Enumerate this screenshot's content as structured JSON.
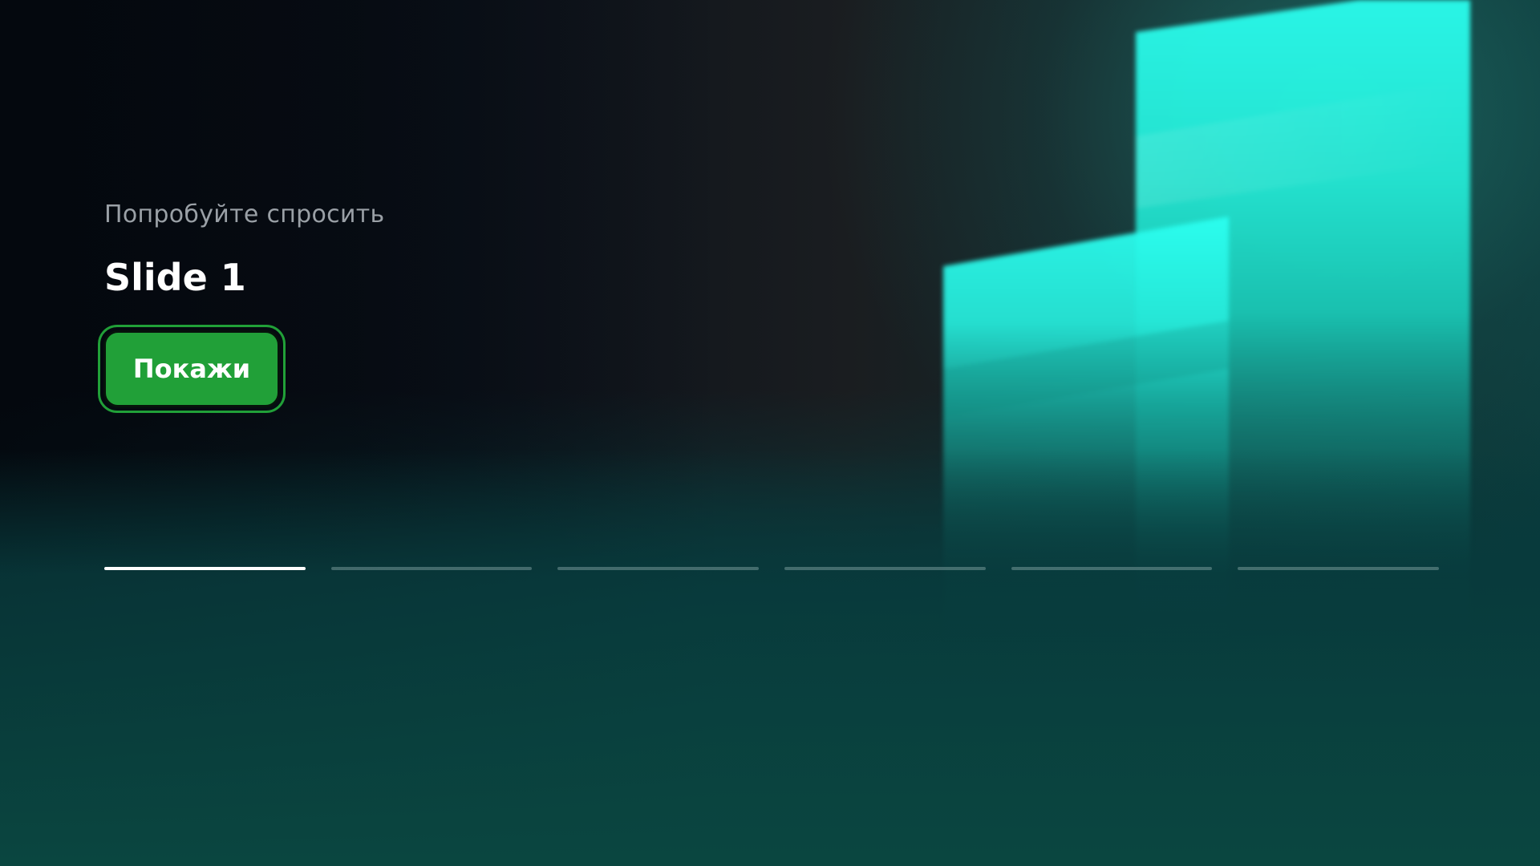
{
  "hero": {
    "eyebrow": "Попробуйте спросить",
    "title": "Slide 1",
    "cta_label": "Покажи"
  },
  "carousel": {
    "slide_count": 6,
    "active_index": 0,
    "segments": [
      {
        "label": "slide-1",
        "active": true
      },
      {
        "label": "slide-2",
        "active": false
      },
      {
        "label": "slide-3",
        "active": false
      },
      {
        "label": "slide-4",
        "active": false
      },
      {
        "label": "slide-5",
        "active": false
      },
      {
        "label": "slide-6",
        "active": false
      }
    ]
  },
  "colors": {
    "accent_green": "#21a038",
    "accent_cyan": "#2bfff0",
    "background_dark": "#05090f",
    "background_teal": "#0a4840",
    "eyebrow_gray": "#9aa0a6"
  }
}
